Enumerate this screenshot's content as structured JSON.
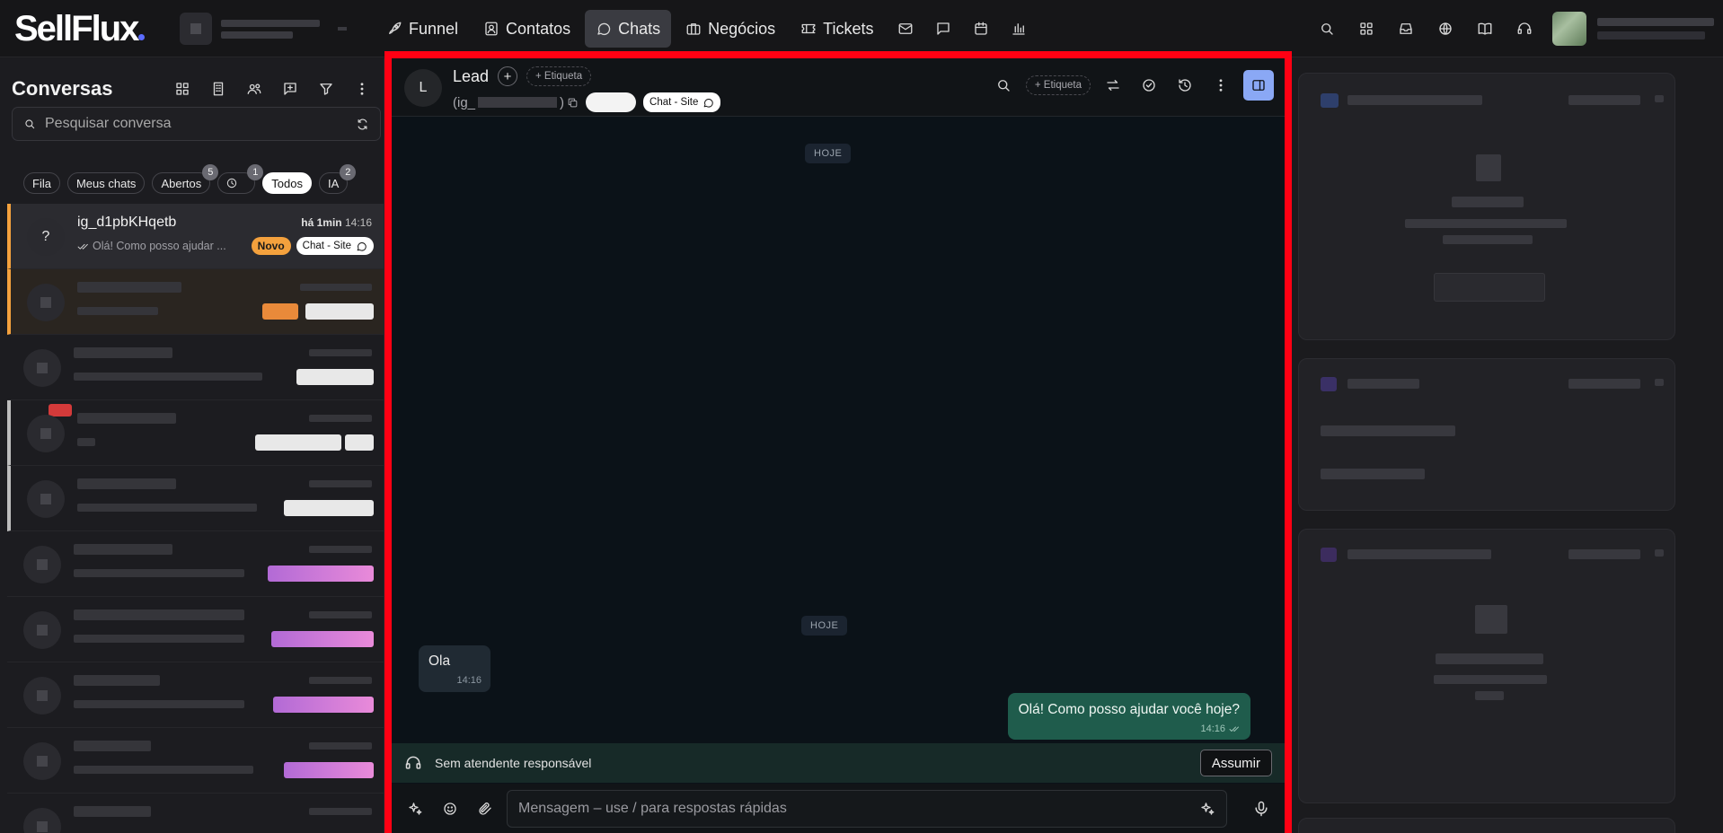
{
  "brand": {
    "name": "SellFlux"
  },
  "nav": {
    "items": [
      {
        "key": "funnel",
        "label": "Funnel",
        "icon": "rocket-icon"
      },
      {
        "key": "contatos",
        "label": "Contatos",
        "icon": "contact-card-icon"
      },
      {
        "key": "chats",
        "label": "Chats",
        "icon": "chat-bubble-icon",
        "active": true
      },
      {
        "key": "negocios",
        "label": "Negócios",
        "icon": "briefcase-icon"
      },
      {
        "key": "tickets",
        "label": "Tickets",
        "icon": "ticket-icon"
      }
    ],
    "icon_only": [
      "mail-icon",
      "message-square-icon",
      "calendar-icon",
      "bar-chart-icon"
    ],
    "right_icons": [
      "search-icon",
      "apps-grid-icon",
      "inbox-icon",
      "globe-icon",
      "book-icon",
      "headset-icon"
    ]
  },
  "sidebar": {
    "title": "Conversas",
    "search_placeholder": "Pesquisar conversa",
    "filters": [
      {
        "label": "Fila"
      },
      {
        "label": "Meus chats"
      },
      {
        "label": "Abertos",
        "badge": "5"
      },
      {
        "label": "",
        "icon": "clock-icon",
        "badge": "1"
      },
      {
        "label": "Todos",
        "active": true
      },
      {
        "label": "IA",
        "badge": "2"
      }
    ],
    "conversations": [
      {
        "name": "ig_d1pbKHqetb",
        "avatar": "?",
        "time_rel": "há 1min",
        "time": "14:16",
        "preview": "Olá! Como posso ajudar ...",
        "tag_status": "Novo",
        "tag_channel": "Chat - Site"
      }
    ]
  },
  "chat": {
    "contact_avatar": "L",
    "contact_name": "Lead",
    "add_label": "+",
    "etiqueta_label": "+ Etiqueta",
    "handle_prefix": "(ig_",
    "channel_tag": "Chat - Site",
    "day_separator": "HOJE",
    "messages": [
      {
        "direction": "in",
        "text": "Ola",
        "time": "14:16"
      },
      {
        "direction": "out",
        "text": "Olá! Como posso ajudar você hoje?",
        "time": "14:16"
      }
    ],
    "assign_text": "Sem atendente responsável",
    "assign_button": "Assumir",
    "composer_placeholder": "Mensagem – use / para respostas rápidas"
  },
  "colors": {
    "accent": "#f4a13d",
    "frame": "#ff0013",
    "outgoing_bubble": "#1f5c4c",
    "panel_button": "#8aa8f5"
  }
}
